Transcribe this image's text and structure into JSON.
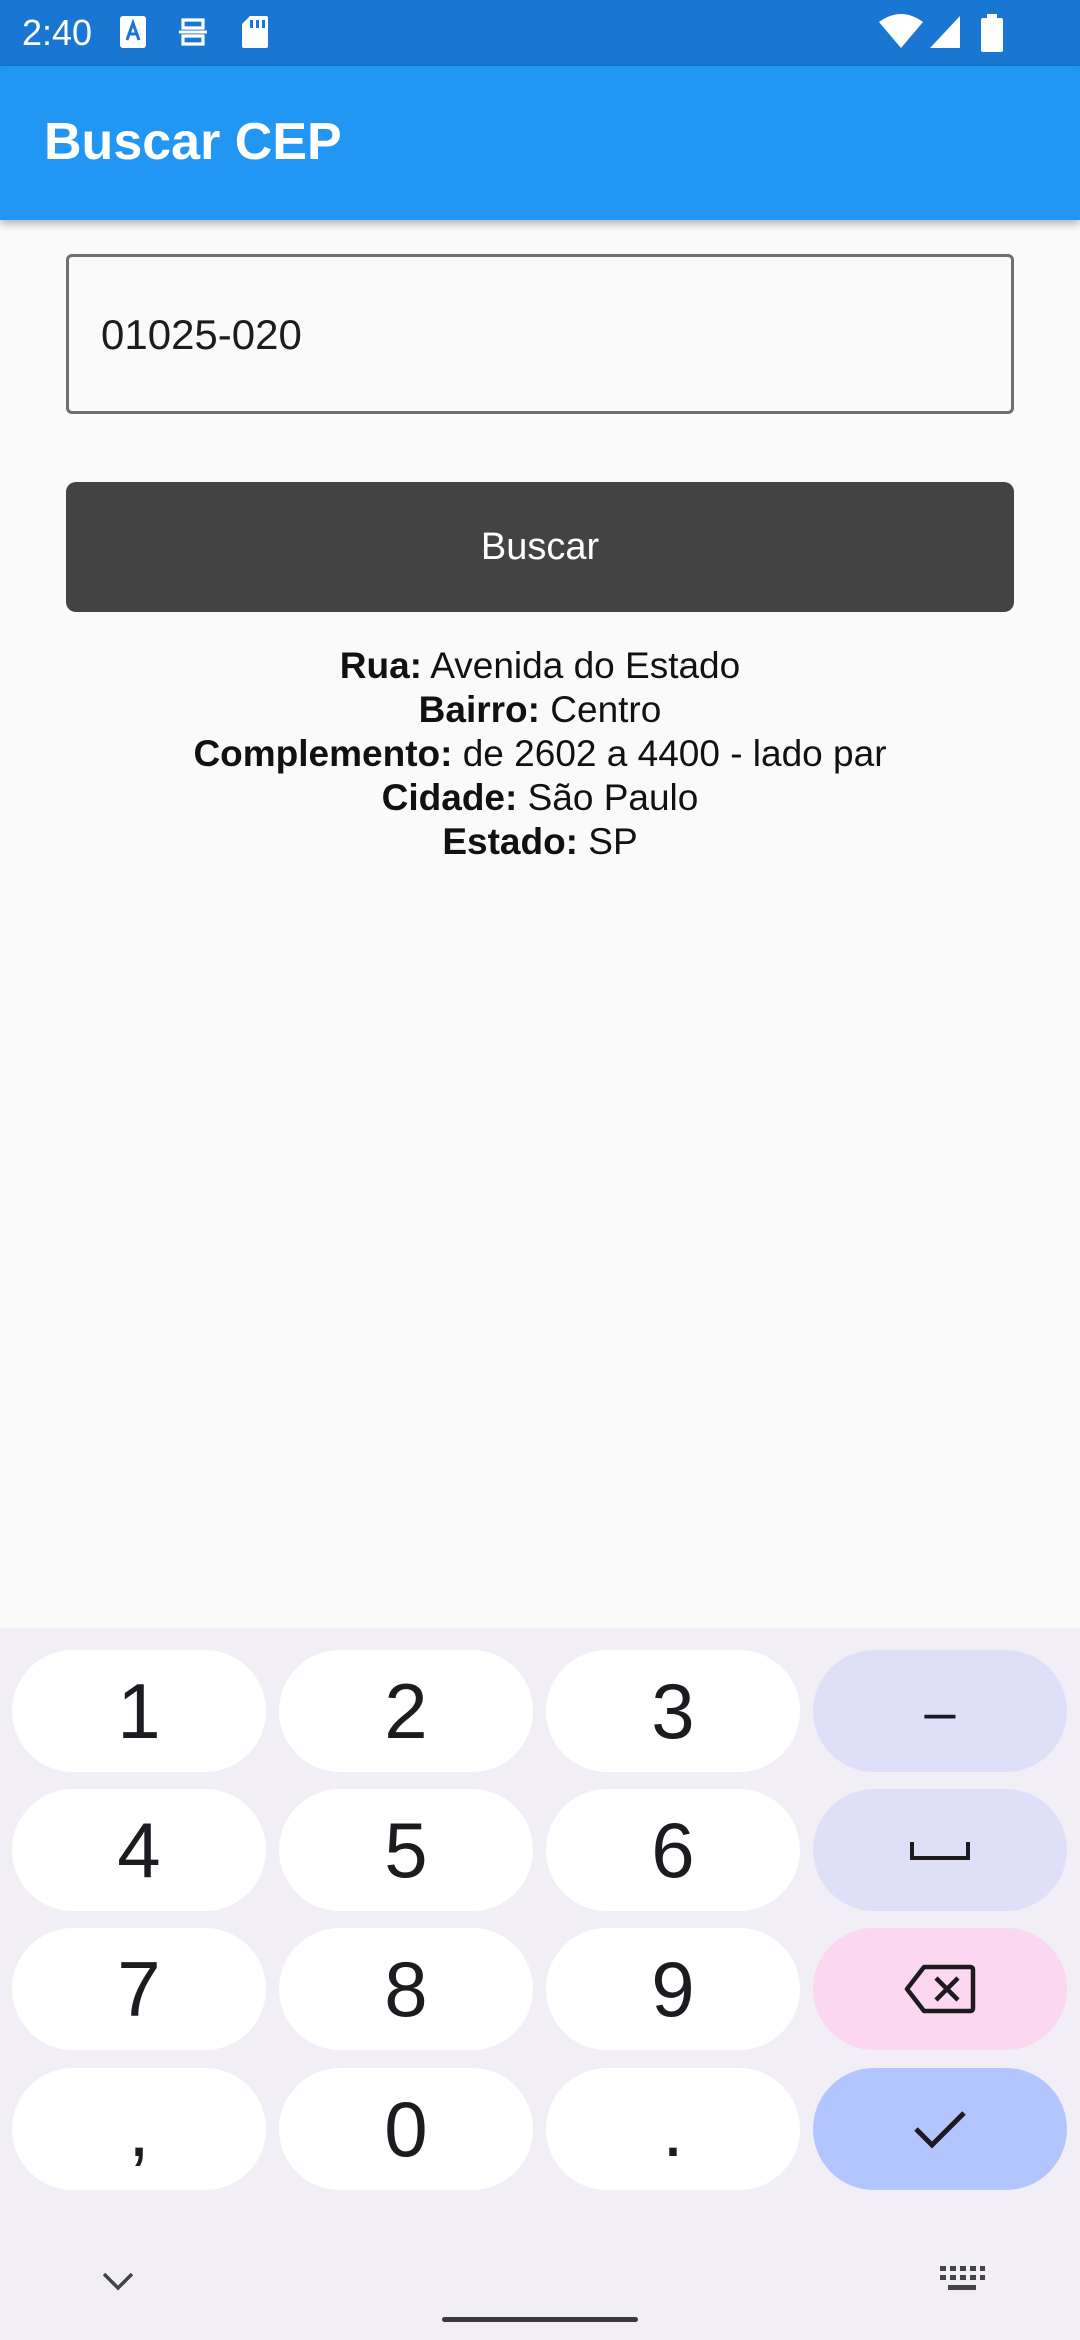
{
  "status_bar": {
    "time": "2:40",
    "left_icons": [
      "keyboard-a-icon",
      "sim-toolkit-icon",
      "sd-card-icon"
    ],
    "right_icons": [
      "wifi-icon",
      "cell-signal-icon",
      "battery-icon"
    ]
  },
  "app_bar": {
    "title": "Buscar CEP"
  },
  "form": {
    "cep_value": "01025-020",
    "search_label": "Buscar"
  },
  "result": {
    "rua_label": "Rua:",
    "rua_value": "Avenida do Estado",
    "bairro_label": "Bairro:",
    "bairro_value": "Centro",
    "complemento_label": "Complemento:",
    "complemento_value": "de 2602 a 4400 - lado par",
    "cidade_label": "Cidade:",
    "cidade_value": "São Paulo",
    "estado_label": "Estado:",
    "estado_value": "SP"
  },
  "keyboard": {
    "keys": [
      "1",
      "2",
      "3",
      "4",
      "5",
      "6",
      "7",
      "8",
      "9",
      ",",
      "0",
      "."
    ],
    "minus_key": "–",
    "space_icon": "space-icon",
    "delete_icon": "backspace-icon",
    "done_icon": "check-icon",
    "collapse_icon": "chevron-down-icon",
    "switch_icon": "keyboard-icon"
  },
  "colors": {
    "status_bar": "#1976d2",
    "app_bar": "#2196f3",
    "button": "#434343",
    "keyboard_bg": "#f1eff5",
    "key_fn": "#dfe0f7",
    "key_delete": "#fbd7f2",
    "key_done": "#b2c5ff"
  }
}
